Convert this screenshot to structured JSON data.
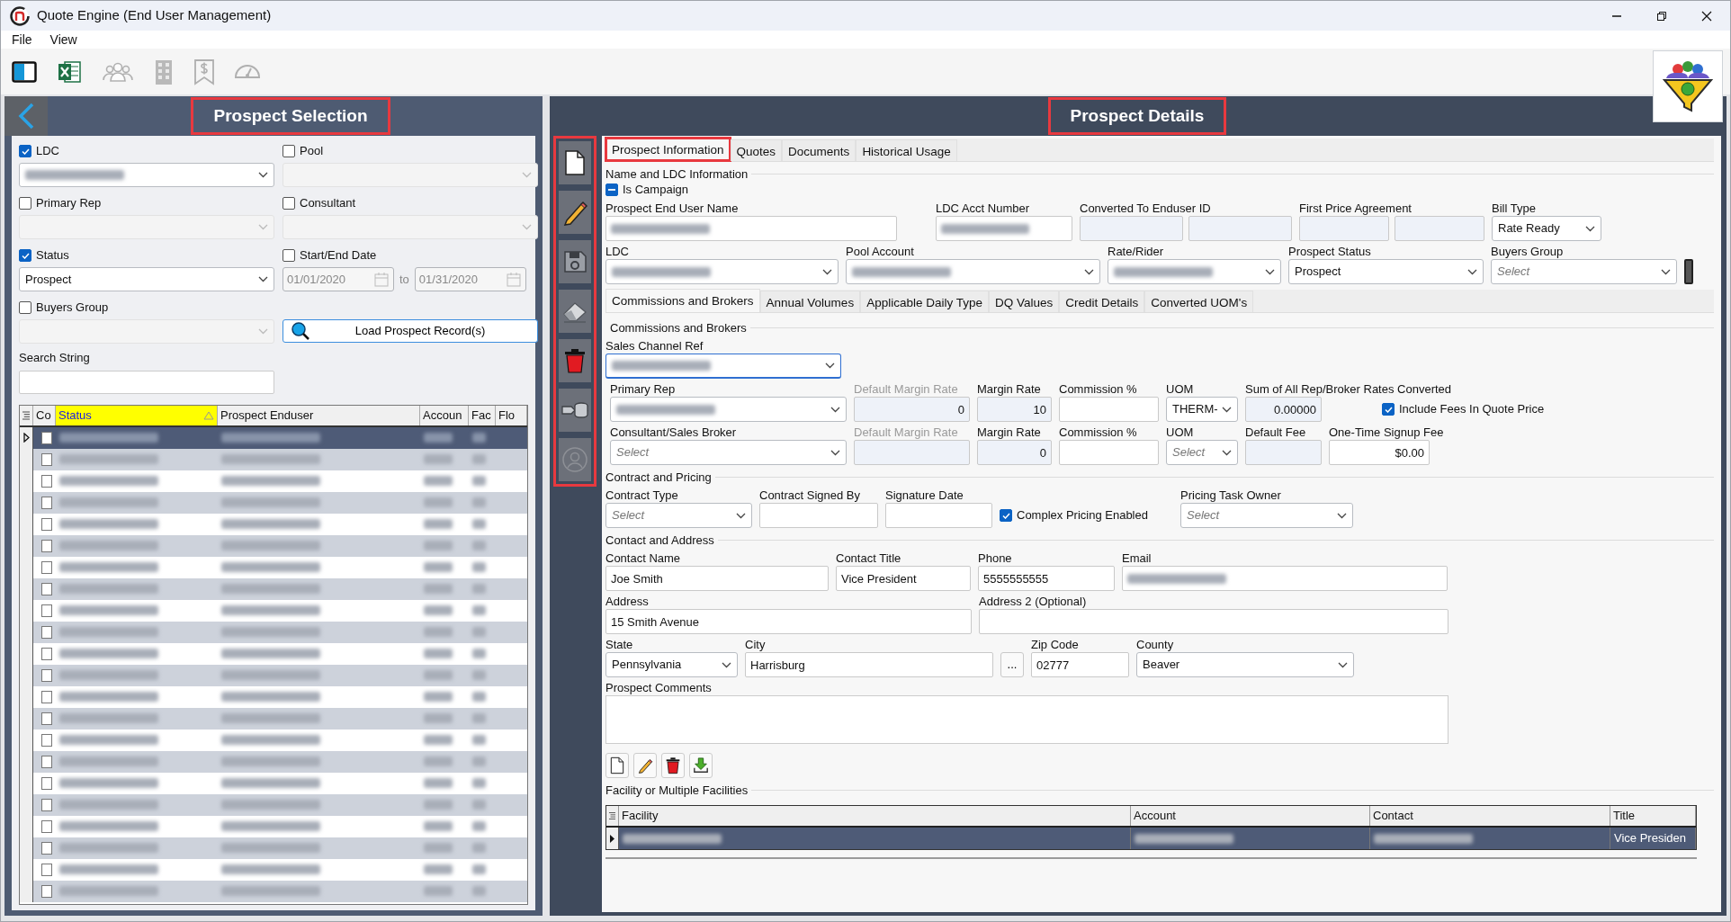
{
  "window": {
    "title": "Quote Engine (End User Management)"
  },
  "menu": [
    "File",
    "View"
  ],
  "toolbar": [
    {
      "kind": "panel",
      "disabled": false
    },
    {
      "kind": "excel",
      "disabled": false
    },
    {
      "kind": "people",
      "disabled": true
    },
    {
      "kind": "building",
      "disabled": true
    },
    {
      "kind": "dollar",
      "disabled": true
    },
    {
      "kind": "gauge",
      "disabled": true
    }
  ],
  "selection": {
    "title": "Prospect Selection",
    "highlighted": true,
    "filters": [
      {
        "kind": "select",
        "label": "LDC",
        "checked": true,
        "redacted": true,
        "disabled": false
      },
      {
        "kind": "select",
        "label": "Pool",
        "checked": false,
        "disabled": true
      },
      {
        "kind": "select",
        "label": "Primary Rep",
        "checked": false,
        "disabled": true
      },
      {
        "kind": "select",
        "label": "Consultant",
        "checked": false,
        "disabled": true
      },
      {
        "kind": "select",
        "label": "Status",
        "checked": true,
        "value": "Prospect",
        "disabled": false
      },
      {
        "kind": "dates",
        "label": "Start/End Date",
        "checked": false,
        "from": "01/01/2020",
        "separator": "to",
        "to": "01/31/2020",
        "disabled": true
      },
      {
        "kind": "select",
        "label": "Buyers Group",
        "checked": false,
        "disabled": true
      },
      {
        "kind": "button",
        "label": "Load Prospect Record(s)"
      }
    ],
    "search": {
      "label": "Search String"
    },
    "grid": {
      "columns": [
        {
          "label": "Co",
          "sorted": false
        },
        {
          "label": "Status",
          "sorted": true
        },
        {
          "label": "Prospect Enduser",
          "sorted": false
        },
        {
          "label": "Accoun",
          "sorted": false
        },
        {
          "label": "Fac",
          "sorted": false
        },
        {
          "label": "Flo",
          "sorted": false
        }
      ],
      "rows": [
        {
          "selected": true,
          "checked": false
        },
        {
          "selected": false,
          "checked": false
        },
        {
          "selected": false,
          "checked": false
        },
        {
          "selected": false,
          "checked": false
        },
        {
          "selected": false,
          "checked": false
        },
        {
          "selected": false,
          "checked": false
        },
        {
          "selected": false,
          "checked": false
        },
        {
          "selected": false,
          "checked": false
        },
        {
          "selected": false,
          "checked": false
        },
        {
          "selected": false,
          "checked": false
        },
        {
          "selected": false,
          "checked": false
        },
        {
          "selected": false,
          "checked": false
        },
        {
          "selected": false,
          "checked": false
        },
        {
          "selected": false,
          "checked": false
        },
        {
          "selected": false,
          "checked": false
        },
        {
          "selected": false,
          "checked": false
        },
        {
          "selected": false,
          "checked": false
        },
        {
          "selected": false,
          "checked": false
        },
        {
          "selected": false,
          "checked": false
        },
        {
          "selected": false,
          "checked": false
        },
        {
          "selected": false,
          "checked": false
        },
        {
          "selected": false,
          "checked": false
        }
      ]
    }
  },
  "details": {
    "title": "Prospect Details",
    "highlighted": true,
    "side_toolbar": {
      "highlighted": true,
      "buttons": [
        {
          "kind": "new",
          "disabled": false
        },
        {
          "kind": "edit",
          "disabled": false
        },
        {
          "kind": "save",
          "disabled": false
        },
        {
          "kind": "erase",
          "disabled": false
        },
        {
          "kind": "delete",
          "disabled": false
        },
        {
          "kind": "convert",
          "disabled": false
        },
        {
          "kind": "user",
          "disabled": true
        }
      ]
    },
    "tabs": [
      {
        "label": "Prospect Information",
        "selected": true,
        "highlighted": true
      },
      {
        "label": "Quotes",
        "selected": false,
        "highlighted": false
      },
      {
        "label": "Documents",
        "selected": false,
        "highlighted": false
      },
      {
        "label": "Historical Usage",
        "selected": false,
        "highlighted": false
      }
    ],
    "name_section": {
      "title": "Name and LDC Information",
      "campaign": {
        "label": "Is Campaign",
        "indeterminate": true
      },
      "rows": [
        [
          {
            "kind": "text",
            "label": "Prospect End User Name",
            "redacted": true
          },
          {
            "kind": "text",
            "label": "LDC Acct Number",
            "redacted": true
          },
          {
            "kind": "pair",
            "label": "Converted To Enduser ID",
            "readonly": true
          },
          {
            "kind": "pair",
            "label": "First Price Agreement",
            "readonly": true
          },
          {
            "kind": "select",
            "label": "Bill Type",
            "value": "Rate Ready"
          }
        ],
        [
          {
            "kind": "select",
            "label": "LDC",
            "redacted": true
          },
          {
            "kind": "select",
            "label": "Pool Account",
            "redacted": true
          },
          {
            "kind": "select",
            "label": "Rate/Rider",
            "redacted": true
          },
          {
            "kind": "select",
            "label": "Prospect Status",
            "value": "Prospect"
          },
          {
            "kind": "select",
            "label": "Buyers Group",
            "placeholder": "Select"
          }
        ]
      ]
    },
    "sub_tabs": [
      {
        "label": "Commissions and Brokers",
        "selected": true
      },
      {
        "label": "Annual Volumes",
        "selected": false
      },
      {
        "label": "Applicable Daily Type",
        "selected": false
      },
      {
        "label": "DQ Values",
        "selected": false
      },
      {
        "label": "Credit Details",
        "selected": false
      },
      {
        "label": "Converted UOM's",
        "selected": false
      }
    ],
    "commissions": {
      "title": "Commissions and Brokers",
      "rows": [
        [
          {
            "kind": "select",
            "label": "Sales Channel Ref",
            "redacted": true,
            "focused": true
          }
        ],
        [
          {
            "kind": "select",
            "label": "Primary Rep",
            "redacted": true
          },
          {
            "kind": "number",
            "label": "Default Margin Rate",
            "value": "0",
            "readonly": true,
            "disabled": true
          },
          {
            "kind": "number",
            "label": "Margin Rate",
            "value": "10",
            "readonly": true
          },
          {
            "kind": "number",
            "label": "Commission %"
          },
          {
            "kind": "select",
            "label": "UOM",
            "value": "THERM-"
          },
          {
            "kind": "number",
            "label": "Sum of All Rep/Broker Rates Converted",
            "value": "0.00000",
            "readonly": true
          },
          {
            "kind": "check",
            "label": "Include Fees In Quote Price",
            "checked": true
          }
        ],
        [
          {
            "kind": "select",
            "label": "Consultant/Sales Broker",
            "placeholder": "Select"
          },
          {
            "kind": "number",
            "label": "Default Margin Rate",
            "readonly": true,
            "disabled": true
          },
          {
            "kind": "number",
            "label": "Margin Rate",
            "value": "0",
            "readonly": true
          },
          {
            "kind": "number",
            "label": "Commission %"
          },
          {
            "kind": "select",
            "label": "UOM",
            "placeholder": "Select"
          },
          {
            "kind": "number",
            "label": "Default Fee",
            "readonly": true
          },
          {
            "kind": "number",
            "label": "One-Time Signup Fee",
            "value": "$0.00"
          }
        ]
      ]
    },
    "contract": {
      "title": "Contract and Pricing",
      "rows": [
        [
          {
            "kind": "select",
            "label": "Contract Type",
            "placeholder": "Select"
          },
          {
            "kind": "text",
            "label": "Contract Signed By"
          },
          {
            "kind": "text",
            "label": "Signature Date"
          },
          {
            "kind": "check",
            "label": "Complex Pricing Enabled",
            "checked": true
          },
          {
            "kind": "select",
            "label": "Pricing Task Owner",
            "placeholder": "Select"
          }
        ]
      ]
    },
    "contact": {
      "title": "Contact and Address",
      "rows": [
        {
          "fields": [
            {
              "kind": "text",
              "label": "Contact Name",
              "value": "Joe Smith"
            },
            {
              "kind": "text",
              "label": "Contact Title",
              "value": "Vice President"
            },
            {
              "kind": "text",
              "label": "Phone",
              "value": "5555555555"
            },
            {
              "kind": "text",
              "label": "Email",
              "redacted": true
            }
          ]
        },
        {
          "fields": [
            {
              "kind": "text",
              "label": "Address",
              "value": "15 Smith Avenue"
            },
            {
              "kind": "text",
              "label": "Address 2 (Optional)"
            }
          ]
        },
        {
          "fields": [
            {
              "kind": "select",
              "label": "State",
              "value": "Pennsylvania"
            },
            {
              "kind": "text",
              "label": "City",
              "value": "Harrisburg"
            },
            {
              "kind": "button",
              "label": "..."
            },
            {
              "kind": "text",
              "label": "Zip Code",
              "value": "02777"
            },
            {
              "kind": "select",
              "label": "County",
              "value": "Beaver"
            }
          ]
        },
        {
          "fields": [
            {
              "kind": "textarea",
              "label": "Prospect Comments"
            }
          ]
        }
      ]
    },
    "facility_toolbar": [
      {
        "kind": "new"
      },
      {
        "kind": "edit"
      },
      {
        "kind": "delete"
      },
      {
        "kind": "download"
      }
    ],
    "facilities": {
      "title": "Facility or Multiple Facilities",
      "columns": [
        "Facility",
        "Account",
        "Contact",
        "Title"
      ],
      "rows": [
        {
          "selected": true,
          "cells": [
            {
              "redacted": true
            },
            {
              "redacted": true
            },
            {
              "redacted": true
            },
            {
              "value": "Vice Presiden"
            }
          ]
        }
      ]
    }
  }
}
